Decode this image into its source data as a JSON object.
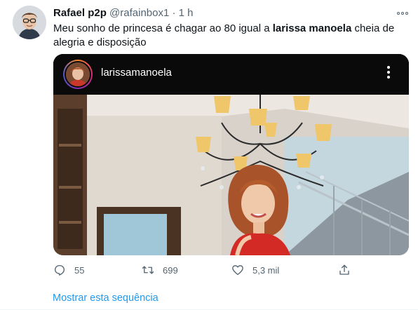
{
  "tweet": {
    "author": {
      "display_name": "Rafael p2p",
      "handle": "@rafainbox1",
      "separator": "·",
      "time": "1 h"
    },
    "text_before": "Meu sonho de princesa é chagar ao 80 igual a ",
    "mention": "larissa manoela",
    "text_after": " cheia de alegria e disposição",
    "embedded_post": {
      "username": "larissamanoela"
    },
    "actions": {
      "replies": "55",
      "retweets": "699",
      "likes": "5,3 mil"
    },
    "show_thread_label": "Mostrar esta sequência"
  },
  "icons": {
    "more": "more-horizontal-icon",
    "reply": "reply-icon",
    "retweet": "retweet-icon",
    "like": "heart-icon",
    "share": "share-icon",
    "post_menu": "more-vertical-icon"
  },
  "colors": {
    "link": "#1d9bf0",
    "secondary_text": "#536471",
    "primary_text": "#0f1419",
    "ig_bar": "#0a0a0a"
  }
}
